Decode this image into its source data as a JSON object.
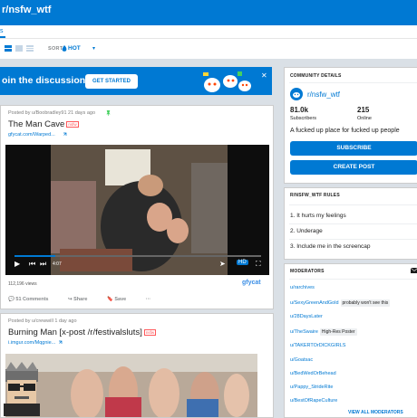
{
  "header": {
    "title": "r/nsfw_wtf",
    "tab_label": "s"
  },
  "sortbar": {
    "sort_label": "SORT",
    "sort_value": "HOT",
    "dropdown_glyph": "▾"
  },
  "banner": {
    "text": "oin the discussion",
    "cta": "GET STARTED",
    "close_glyph": "✕"
  },
  "post1": {
    "meta": "Posted by u/Boobradley91 21 days ago",
    "pin_glyph": "📌",
    "title": "The Man Cave",
    "nsfw": "nsfw",
    "link": "gfycat.com/Warped...",
    "time": "4:07",
    "views": "112,196 views",
    "brand": "gfycat",
    "comments": "51 Comments",
    "share": "Share",
    "save": "Save",
    "more": "···"
  },
  "post2": {
    "meta": "Posted by u/crewwill 1 day ago",
    "title": "Burning Man [x-post /r/festivalsluts]",
    "nsfw": "nsfw",
    "link": "i.imgur.com/Mqgnie..."
  },
  "community": {
    "heading": "COMMUNITY DETAILS",
    "name": "r/nsfw_wtf",
    "subscribers_count": "81.0k",
    "subscribers_label": "Subscribers",
    "online_count": "215",
    "online_label": "Online",
    "description": "A fucked up place for fucked up people",
    "subscribe": "SUBSCRIBE",
    "create_post": "CREATE POST"
  },
  "rules": {
    "heading": "R/NSFW_WTF RULES",
    "items": [
      "1. It hurts my feelings",
      "2. Underage",
      "3. Include me in the screencap"
    ]
  },
  "moderators": {
    "heading": "MODERATORS",
    "list": [
      {
        "name": "u/rarchives",
        "flair": ""
      },
      {
        "name": "u/SexyGreenAndGold",
        "flair": "probably won't see this"
      },
      {
        "name": "u/28DaysLater",
        "flair": ""
      },
      {
        "name": "u/TheSwaire",
        "flair": "High-Res Poster"
      },
      {
        "name": "u/TAKERTOrDICKGIRLS",
        "flair": ""
      },
      {
        "name": "u/Goatsac",
        "flair": ""
      },
      {
        "name": "u/BedWedOrBehead",
        "flair": ""
      },
      {
        "name": "u/Pappy_StrideRite",
        "flair": ""
      },
      {
        "name": "u/BestOfRapeCulture",
        "flair": ""
      }
    ],
    "view_all": "VIEW ALL MODERATORS"
  },
  "colors": {
    "brand_blue": "#0079d3",
    "nsfw_red": "#ff585b",
    "page_bg": "#dae0e6"
  }
}
